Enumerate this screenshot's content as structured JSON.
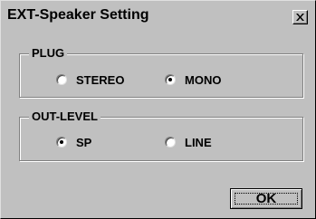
{
  "dialog": {
    "title": "EXT-Speaker Setting",
    "close_icon": "close-x-icon"
  },
  "plug": {
    "label": "PLUG",
    "options": [
      {
        "label": "STEREO",
        "selected": false
      },
      {
        "label": "MONO",
        "selected": true
      }
    ]
  },
  "out_level": {
    "label": "OUT-LEVEL",
    "options": [
      {
        "label": "SP",
        "selected": true
      },
      {
        "label": "LINE",
        "selected": false
      }
    ]
  },
  "buttons": {
    "ok_label": "OK"
  },
  "colors": {
    "face": "#c0c0c0",
    "shadow": "#808080",
    "highlight": "#ffffff"
  }
}
